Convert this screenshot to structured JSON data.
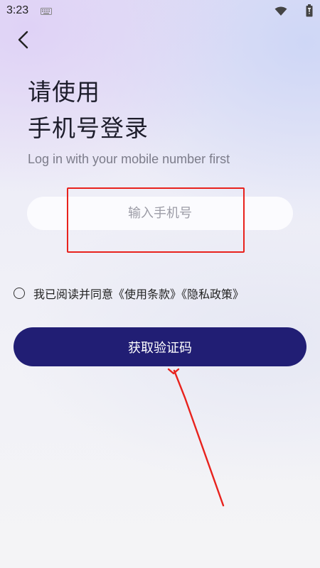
{
  "status_bar": {
    "time": "3:23",
    "icons": [
      "keyboard-icon",
      "wifi-icon",
      "battery-icon"
    ]
  },
  "header": {
    "back_icon": "chevron-left-icon"
  },
  "login": {
    "title_line1": "请使用",
    "title_line2": "手机号登录",
    "subtitle": "Log in with your mobile number first",
    "phone_placeholder": "输入手机号",
    "agreement": {
      "prefix": "我已阅读并同意",
      "terms": "《使用条款》",
      "privacy": "《隐私政策》",
      "checked": false
    },
    "submit_label": "获取验证码"
  },
  "annotations": {
    "highlight_color": "#e8221d",
    "arrow_color": "#e8221d"
  },
  "colors": {
    "button_bg": "#211e74",
    "input_bg": "#fbfbfe"
  }
}
